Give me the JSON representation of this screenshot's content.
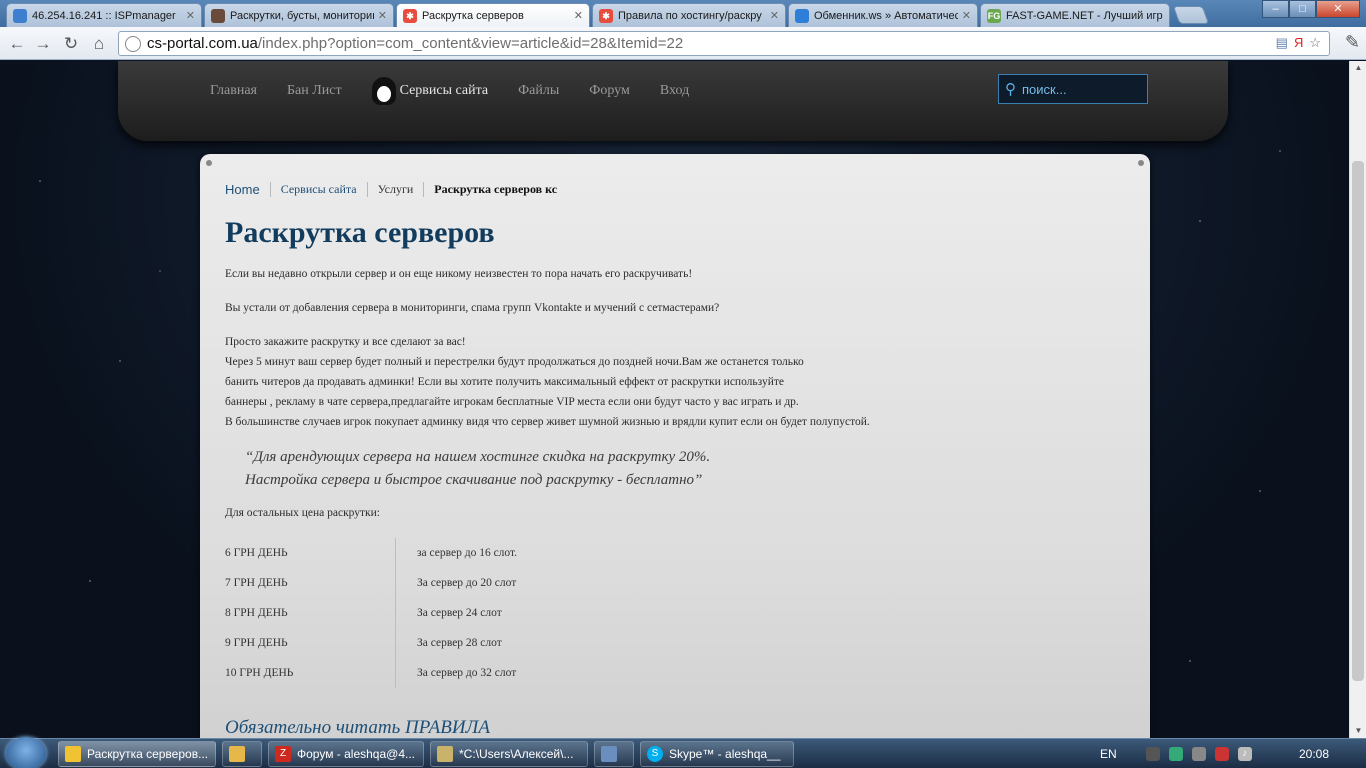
{
  "browser": {
    "tabs": [
      {
        "label": "46.254.16.241 :: ISPmanager",
        "icon_color": "#3f7fd0"
      },
      {
        "label": "Раскрутки, бусты, мониторинг",
        "icon_color": "#6a4a3a"
      },
      {
        "label": "Раскрутка серверов",
        "icon_color": "#e74c3c"
      },
      {
        "label": "Правила по хостингу/раскру",
        "icon_color": "#e74c3c"
      },
      {
        "label": "Обменник.ws » Автоматичес",
        "icon_color": "#2f7ed8"
      },
      {
        "label": "FAST-GAME.NET - Лучший игр",
        "icon_color": "#6aa84f"
      }
    ],
    "active_tab_index": 2,
    "url_host": "cs-portal.com.ua",
    "url_path": "/index.php?option=com_content&view=article&id=28&Itemid=22",
    "window_buttons": {
      "minimize": "–",
      "maximize": "□",
      "close": "✕"
    }
  },
  "site_nav": {
    "items": [
      "Главная",
      "Бан Лист",
      "Сервисы сайта",
      "Файлы",
      "Форум",
      "Вход"
    ],
    "active_index": 2,
    "search_placeholder": "поиск..."
  },
  "breadcrumb": [
    "Home",
    "Сервисы сайта",
    "Услуги",
    "Раскрутка серверов кс"
  ],
  "article": {
    "title": "Раскрутка серверов",
    "p1": "Если вы недавно открыли сервер и он еще никому неизвестен то пора начать его раскручивать!",
    "p2": "Вы устали от добавления сервера в мониторинги, спама групп Vkontakte и мучений с сетмастерами?",
    "p3_lines": [
      "Просто закажите раскрутку и все сделают за вас!",
      "Через 5 минут ваш сервер будет полный и перестрелки будут продолжаться до поздней ночи.Вам же останется только",
      "банить читеров да продавать админки! Если вы хотите получить максимальный еффект от раскрутки используйте",
      "баннеры , рекламу в чате сервера,предлагайте игрокам бесплатные VIP места если они будут часто у вас играть и др.",
      "В большинстве случаев игрок покупает админку видя что сервер живет шумной жизнью и врядли купит если он будет полупустой."
    ],
    "quote_line1": "“Для арендующих сервера на нашем хостинге скидка на раскрутку 20%.",
    "quote_line2": "Настройка сервера и быстрое скачивание под раскрутку - бесплатно”",
    "prices_intro": "Для остальных цена раскрутки:",
    "prices": [
      {
        "price": "6 ГРН ДЕНЬ",
        "desc": "за сервер до 16 слот."
      },
      {
        "price": "7 ГРН ДЕНЬ",
        "desc": "За сервер до 20 слот"
      },
      {
        "price": "8 ГРН ДЕНЬ",
        "desc": "За сервер 24 слот"
      },
      {
        "price": "9 ГРН ДЕНЬ",
        "desc": "За сервер 28 слот"
      },
      {
        "price": "10 ГРН ДЕНЬ",
        "desc": "За сервер до 32 слот"
      }
    ],
    "rules_link": "Обязательно читать ПРАВИЛА"
  },
  "taskbar": {
    "items": [
      {
        "label": "Раскрутка серверов...",
        "icon_color": "#f1c232"
      },
      {
        "label": "",
        "icon_color": "#e6b84a"
      },
      {
        "label": "Форум - aleshqa@4...",
        "icon_color": "#cc2a1f"
      },
      {
        "label": "*C:\\Users\\Алексей\\...",
        "icon_color": "#c9b26a"
      },
      {
        "label": "",
        "icon_color": "#6a8fbf"
      },
      {
        "label": "Skype™ - aleshqa__",
        "icon_color": "#00aff0"
      }
    ],
    "language": "EN",
    "clock": "20:08"
  }
}
